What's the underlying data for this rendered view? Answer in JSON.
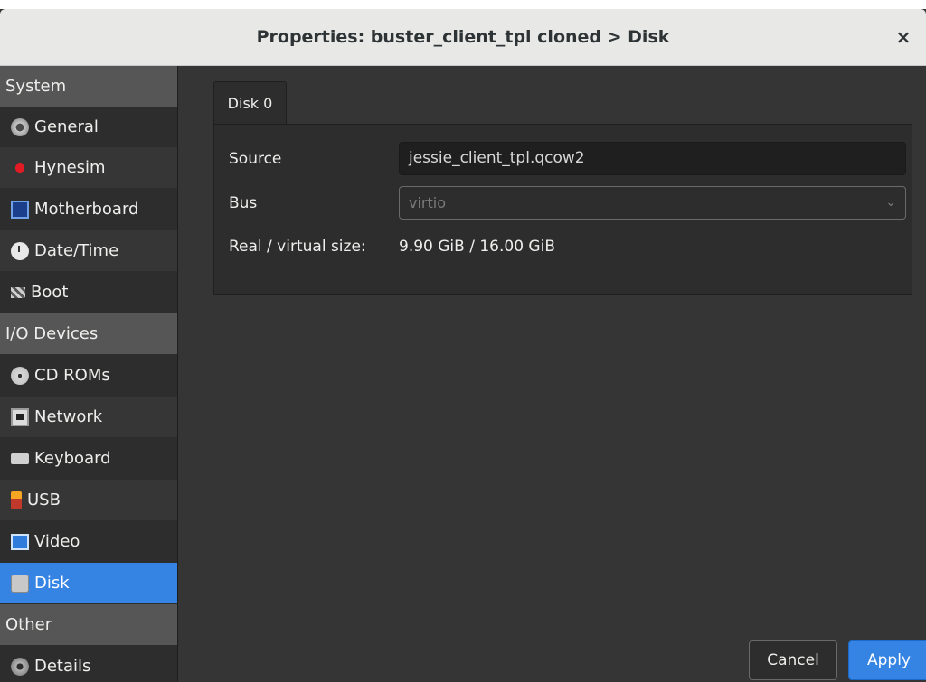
{
  "window": {
    "title": "Properties: buster_client_tpl cloned > Disk",
    "close_symbol": "×"
  },
  "sidebar": {
    "items": [
      {
        "type": "header",
        "label": "System"
      },
      {
        "type": "item",
        "label": "General",
        "icon": "gear-icon"
      },
      {
        "type": "item",
        "label": "Hynesim",
        "icon": "hynesim-icon"
      },
      {
        "type": "item",
        "label": "Motherboard",
        "icon": "motherboard-icon"
      },
      {
        "type": "item",
        "label": "Date/Time",
        "icon": "clock-icon"
      },
      {
        "type": "item",
        "label": "Boot",
        "icon": "boot-icon"
      },
      {
        "type": "header",
        "label": "I/O Devices"
      },
      {
        "type": "item",
        "label": "CD ROMs",
        "icon": "cdrom-icon"
      },
      {
        "type": "item",
        "label": "Network",
        "icon": "network-icon"
      },
      {
        "type": "item",
        "label": "Keyboard",
        "icon": "keyboard-icon"
      },
      {
        "type": "item",
        "label": "USB",
        "icon": "usb-icon"
      },
      {
        "type": "item",
        "label": "Video",
        "icon": "video-icon"
      },
      {
        "type": "item",
        "label": "Disk",
        "icon": "disk-icon",
        "selected": true
      },
      {
        "type": "header",
        "label": "Other"
      },
      {
        "type": "item",
        "label": "Details",
        "icon": "details-icon"
      }
    ]
  },
  "main": {
    "tab_label": "Disk 0",
    "source_label": "Source",
    "source_value": "jessie_client_tpl.qcow2",
    "bus_label": "Bus",
    "bus_value": "virtio",
    "size_label": "Real / virtual size:",
    "size_value": "9.90 GiB / 16.00 GiB"
  },
  "buttons": {
    "cancel_label": "Cancel",
    "apply_label": "Apply"
  },
  "colors": {
    "accent": "#3584e4",
    "sidebar_bg": "#2d2d2d",
    "header_bg": "#565656"
  }
}
